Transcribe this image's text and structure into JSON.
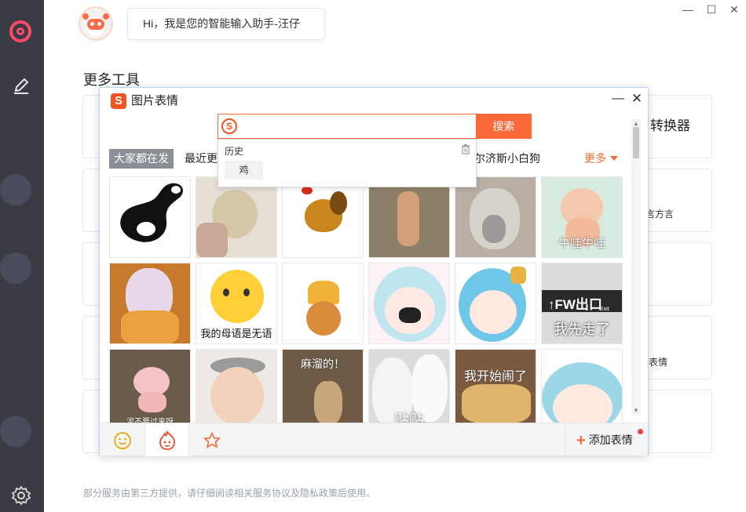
{
  "assistant": {
    "greeting": "Hi，我是您的智能输入助手-汪仔"
  },
  "section": {
    "title": "更多工具"
  },
  "background_cards": [
    {
      "label": "转换器"
    },
    {
      "label": "言方言"
    },
    {
      "label": "表情"
    }
  ],
  "footer": {
    "note": "部分服务由第三方提供，请仔细阅读相关服务协议及隐私政策后使用。"
  },
  "popup": {
    "title": "图片表情",
    "logo_letter": "S",
    "search": {
      "placeholder": "",
      "button": "搜索"
    },
    "history": {
      "label": "历史",
      "items": [
        "鸡"
      ]
    },
    "tags": [
      "大家都在发",
      "最近更",
      "尔济斯小白狗"
    ],
    "more_label": "更多",
    "stickers": [
      {
        "caption": ""
      },
      {
        "caption": ""
      },
      {
        "caption": ""
      },
      {
        "caption": ""
      },
      {
        "caption": ""
      },
      {
        "caption": "牛哇牛哇"
      },
      {
        "caption": ""
      },
      {
        "caption": "我的母语是无语"
      },
      {
        "caption": ""
      },
      {
        "caption": ""
      },
      {
        "caption": ""
      },
      {
        "caption": "我先走了"
      },
      {
        "caption": "泥不要过来呀"
      },
      {
        "caption": ""
      },
      {
        "caption": "麻溜的！"
      },
      {
        "caption": "贴贴"
      },
      {
        "caption": "我开始闹了"
      },
      {
        "caption": ""
      }
    ],
    "sign_text": "↑FW出口",
    "sign_sub": "Exit",
    "add_label": "添加表情"
  },
  "colors": {
    "accent": "#fa6a38",
    "brand": "#f4521f",
    "sidebar": "#3b3c43"
  }
}
